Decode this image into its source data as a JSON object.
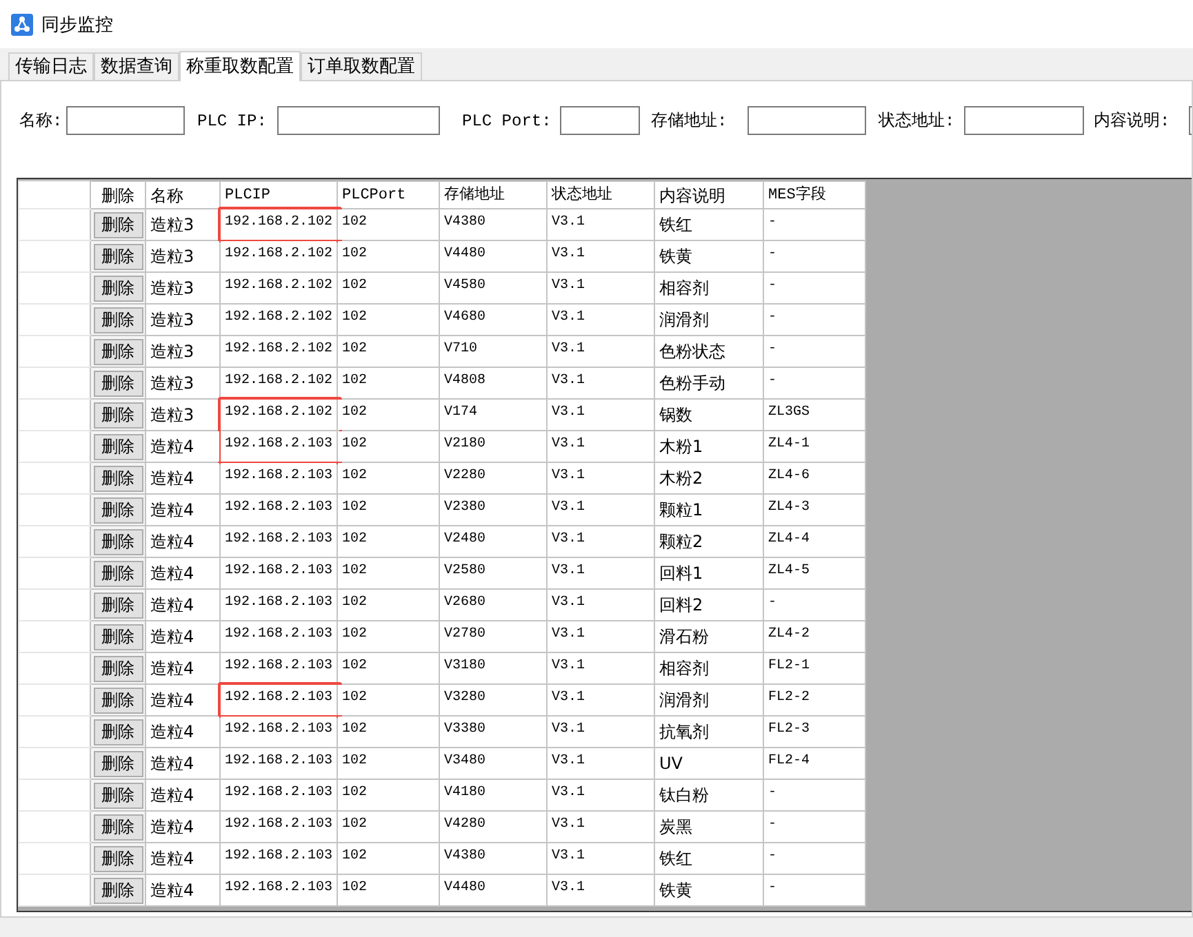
{
  "window": {
    "title": "同步监控"
  },
  "tabs": [
    {
      "label": "传输日志",
      "selected": false
    },
    {
      "label": "数据查询",
      "selected": false
    },
    {
      "label": "称重取数配置",
      "selected": true
    },
    {
      "label": "订单取数配置",
      "selected": false
    }
  ],
  "form": {
    "fields": [
      {
        "label": "名称:"
      },
      {
        "label": "PLC IP:"
      },
      {
        "label": "PLC Port:"
      },
      {
        "label": "存储地址:"
      },
      {
        "label": "状态地址:"
      },
      {
        "label": "内容说明:"
      }
    ]
  },
  "table": {
    "columns": [
      {
        "label": "删除",
        "kind": "button"
      },
      {
        "label": "名称",
        "kind": "text"
      },
      {
        "label": "PLCIP",
        "kind": "code"
      },
      {
        "label": "PLCPort",
        "kind": "code"
      },
      {
        "label": "存储地址",
        "kind": "code"
      },
      {
        "label": "状态地址",
        "kind": "code"
      },
      {
        "label": "内容说明",
        "kind": "text"
      },
      {
        "label": "MES字段",
        "kind": "code"
      }
    ],
    "rows": [
      {
        "cells": [
          "删除",
          "造粒3",
          "192.168.2.102",
          "102",
          "V4380",
          "V3.1",
          "铁红",
          "-"
        ],
        "highlighted": true
      },
      {
        "cells": [
          "删除",
          "造粒3",
          "192.168.2.102",
          "102",
          "V4480",
          "V3.1",
          "铁黄",
          "-"
        ],
        "highlighted": false
      },
      {
        "cells": [
          "删除",
          "造粒3",
          "192.168.2.102",
          "102",
          "V4580",
          "V3.1",
          "相容剂",
          "-"
        ],
        "highlighted": false
      },
      {
        "cells": [
          "删除",
          "造粒3",
          "192.168.2.102",
          "102",
          "V4680",
          "V3.1",
          "润滑剂",
          "-"
        ],
        "highlighted": false
      },
      {
        "cells": [
          "删除",
          "造粒3",
          "192.168.2.102",
          "102",
          "V710",
          "V3.1",
          "色粉状态",
          "-"
        ],
        "highlighted": false
      },
      {
        "cells": [
          "删除",
          "造粒3",
          "192.168.2.102",
          "102",
          "V4808",
          "V3.1",
          "色粉手动",
          "-"
        ],
        "highlighted": false
      },
      {
        "cells": [
          "删除",
          "造粒3",
          "192.168.2.102",
          "102",
          "V174",
          "V3.1",
          "锅数",
          "ZL3GS"
        ],
        "highlighted": true
      },
      {
        "cells": [
          "删除",
          "造粒4",
          "192.168.2.103",
          "102",
          "V2180",
          "V3.1",
          "木粉1",
          "ZL4-1"
        ],
        "highlighted": true
      },
      {
        "cells": [
          "删除",
          "造粒4",
          "192.168.2.103",
          "102",
          "V2280",
          "V3.1",
          "木粉2",
          "ZL4-6"
        ],
        "highlighted": false
      },
      {
        "cells": [
          "删除",
          "造粒4",
          "192.168.2.103",
          "102",
          "V2380",
          "V3.1",
          "颗粒1",
          "ZL4-3"
        ],
        "highlighted": false
      },
      {
        "cells": [
          "删除",
          "造粒4",
          "192.168.2.103",
          "102",
          "V2480",
          "V3.1",
          "颗粒2",
          "ZL4-4"
        ],
        "highlighted": false
      },
      {
        "cells": [
          "删除",
          "造粒4",
          "192.168.2.103",
          "102",
          "V2580",
          "V3.1",
          "回料1",
          "ZL4-5"
        ],
        "highlighted": false
      },
      {
        "cells": [
          "删除",
          "造粒4",
          "192.168.2.103",
          "102",
          "V2680",
          "V3.1",
          "回料2",
          "-"
        ],
        "highlighted": false
      },
      {
        "cells": [
          "删除",
          "造粒4",
          "192.168.2.103",
          "102",
          "V2780",
          "V3.1",
          "滑石粉",
          "ZL4-2"
        ],
        "highlighted": false
      },
      {
        "cells": [
          "删除",
          "造粒4",
          "192.168.2.103",
          "102",
          "V3180",
          "V3.1",
          "相容剂",
          "FL2-1"
        ],
        "highlighted": false
      },
      {
        "cells": [
          "删除",
          "造粒4",
          "192.168.2.103",
          "102",
          "V3280",
          "V3.1",
          "润滑剂",
          "FL2-2"
        ],
        "highlighted": true
      },
      {
        "cells": [
          "删除",
          "造粒4",
          "192.168.2.103",
          "102",
          "V3380",
          "V3.1",
          "抗氧剂",
          "FL2-3"
        ],
        "highlighted": false
      },
      {
        "cells": [
          "删除",
          "造粒4",
          "192.168.2.103",
          "102",
          "V3480",
          "V3.1",
          "UV",
          "FL2-4"
        ],
        "highlighted": false
      },
      {
        "cells": [
          "删除",
          "造粒4",
          "192.168.2.103",
          "102",
          "V4180",
          "V3.1",
          "钛白粉",
          "-"
        ],
        "highlighted": false
      },
      {
        "cells": [
          "删除",
          "造粒4",
          "192.168.2.103",
          "102",
          "V4280",
          "V3.1",
          "炭黑",
          "-"
        ],
        "highlighted": false
      },
      {
        "cells": [
          "删除",
          "造粒4",
          "192.168.2.103",
          "102",
          "V4380",
          "V3.1",
          "铁红",
          "-"
        ],
        "highlighted": false
      },
      {
        "cells": [
          "删除",
          "造粒4",
          "192.168.2.103",
          "102",
          "V4480",
          "V3.1",
          "铁黄",
          "-"
        ],
        "highlighted": false
      }
    ]
  }
}
